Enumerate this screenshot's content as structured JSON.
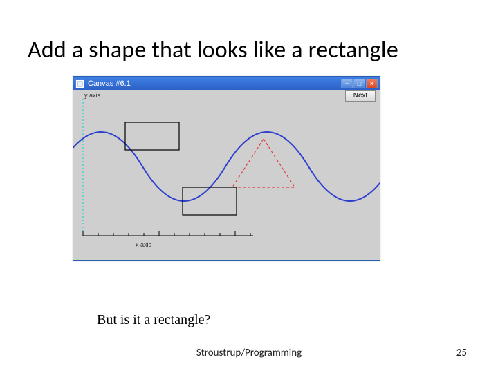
{
  "title": "Add a shape that looks like a rectangle",
  "window": {
    "title": "Canvas #6.1",
    "next_button": "Next",
    "y_axis_label": "y axis",
    "x_axis_label": "x axis"
  },
  "caption": "But is it a rectangle?",
  "footer": "Stroustrup/Programming",
  "page_number": "25",
  "icons": {
    "minimize": "−",
    "maximize": "□",
    "close": "×"
  }
}
